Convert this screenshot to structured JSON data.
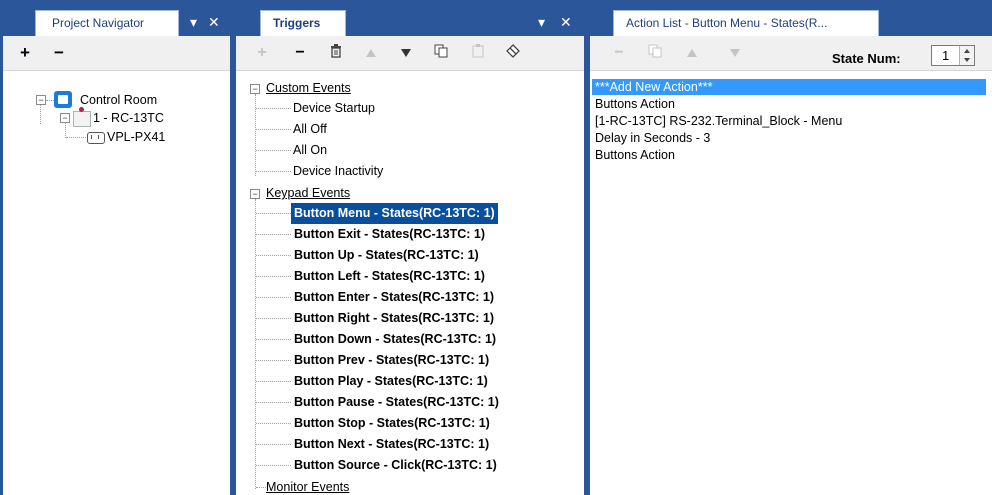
{
  "navigator": {
    "tab_label": "Project Navigator",
    "pin_glyph": "▾",
    "close_glyph": "✕",
    "add_label": "+",
    "remove_label": "−",
    "tree": {
      "root": "Control Room",
      "device": "1 - RC-13TC",
      "child": "VPL-PX41"
    }
  },
  "triggers": {
    "tab_label": "Triggers",
    "pin_glyph": "▾",
    "close_glyph": "✕",
    "toolbar": {
      "add": "+",
      "remove": "−",
      "delete_icon": "trash-icon",
      "up_icon": "arrow-up-icon",
      "down_icon": "arrow-down-icon",
      "copy_icon": "copy-icon",
      "paste_icon": "paste-icon",
      "clear_icon": "eraser-icon"
    },
    "custom_events": {
      "label": "Custom Events",
      "items": [
        "Device Startup",
        "All Off",
        "All On",
        "Device Inactivity"
      ]
    },
    "keypad_events": {
      "label": "Keypad Events",
      "items": [
        "Button Menu - States(RC-13TC: 1)",
        "Button Exit - States(RC-13TC: 1)",
        "Button Up - States(RC-13TC: 1)",
        "Button Left - States(RC-13TC: 1)",
        "Button Enter - States(RC-13TC: 1)",
        "Button Right - States(RC-13TC: 1)",
        "Button Down - States(RC-13TC: 1)",
        "Button Prev - States(RC-13TC: 1)",
        "Button Play - States(RC-13TC: 1)",
        "Button Pause - States(RC-13TC: 1)",
        "Button Stop - States(RC-13TC: 1)",
        "Button Next - States(RC-13TC: 1)",
        "Button Source - Click(RC-13TC: 1)"
      ],
      "selected_index": 0
    },
    "monitor_events": {
      "label": "Monitor Events"
    }
  },
  "actions": {
    "tab_label": "Action List - Button Menu - States(R...",
    "state_label": "State Num:",
    "state_value": "1",
    "items": [
      "***Add New Action***",
      "Buttons Action",
      "[1-RC-13TC] RS-232.Terminal_Block - Menu",
      "Delay in Seconds - 3",
      "Buttons Action"
    ],
    "selected_index": 0
  },
  "colors": {
    "frame": "#2b579a",
    "selection": "#0a4f9c",
    "action_selection": "#3399ff"
  }
}
